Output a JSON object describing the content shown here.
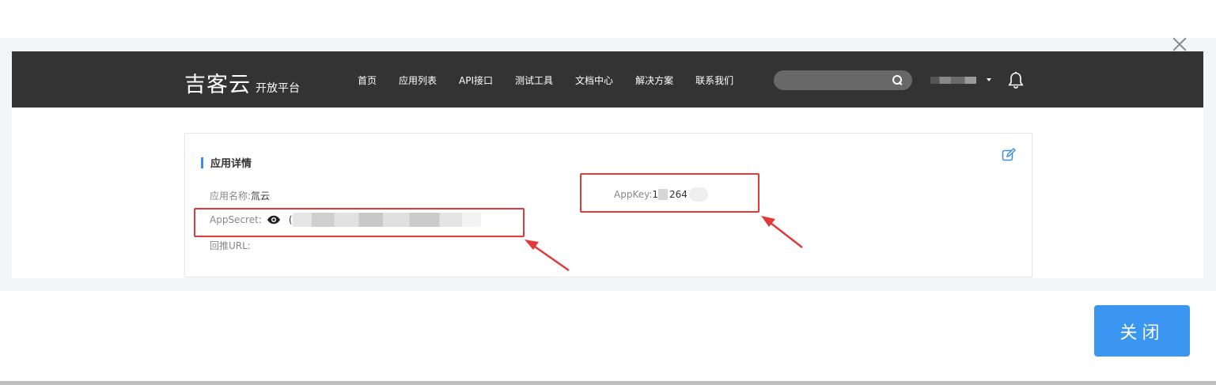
{
  "header": {
    "logo_text": "吉客云",
    "logo_subtitle": "开放平台",
    "nav": [
      "首页",
      "应用列表",
      "API接口",
      "测试工具",
      "文档中心",
      "解决方案",
      "联系我们"
    ],
    "search_placeholder": ""
  },
  "card": {
    "title": "应用详情",
    "app_name_label": "应用名称:",
    "app_name_value": "氚云",
    "app_secret_label": "AppSecret:",
    "app_secret_prefix": "(",
    "callback_url_label": "回推URL:",
    "callback_url_value": "",
    "app_key_label": "AppKey:",
    "app_key_prefix": "1",
    "app_key_visible": "264"
  },
  "footer": {
    "close_button_label": "关闭"
  },
  "colors": {
    "navbar_bg": "#333333",
    "accent_blue": "#3a8ee6",
    "close_button_bg": "#3a96f0",
    "highlight_red": "#e03a3a"
  },
  "icons": [
    "close-icon",
    "search-icon",
    "chevron-down-icon",
    "bell-icon",
    "edit-icon",
    "eye-icon"
  ]
}
